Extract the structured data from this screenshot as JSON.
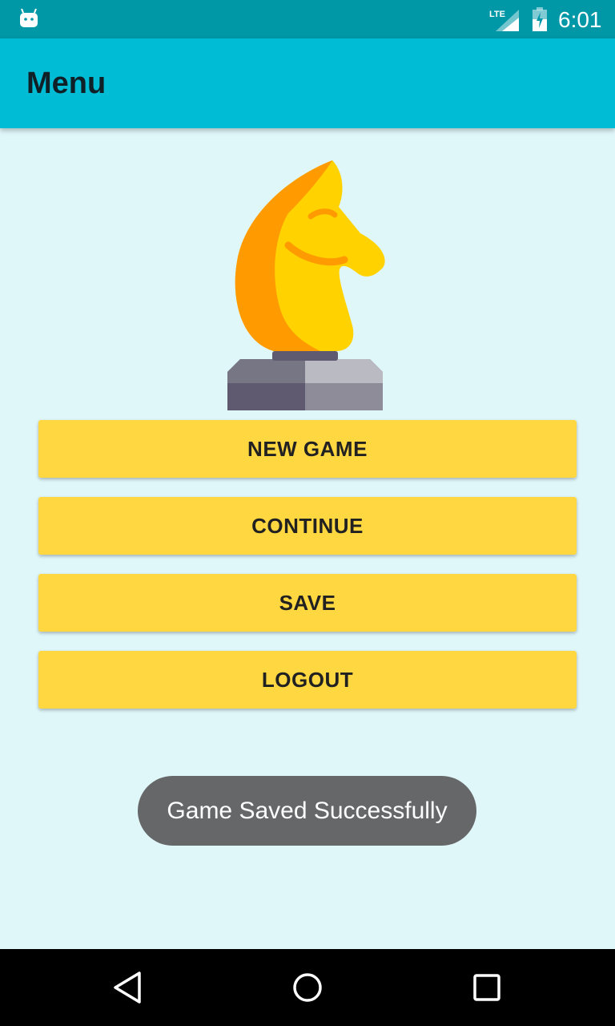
{
  "status_bar": {
    "time": "6:01",
    "network_label": "LTE",
    "icons": [
      "android-icon",
      "lte-signal-icon",
      "battery-icon"
    ]
  },
  "app_bar": {
    "title": "Menu"
  },
  "logo": {
    "icon": "chess-knight-icon"
  },
  "menu": {
    "buttons": [
      {
        "label": "NEW GAME"
      },
      {
        "label": "CONTINUE"
      },
      {
        "label": "SAVE"
      },
      {
        "label": "LOGOUT"
      }
    ]
  },
  "toast": {
    "message": "Game Saved Successfully"
  },
  "nav_bar": {
    "icons": [
      "back-icon",
      "home-icon",
      "recents-icon"
    ]
  },
  "colors": {
    "status_bar": "#0097A7",
    "app_bar": "#00BCD4",
    "background": "#E0F7FA",
    "button": "#FFD740",
    "toast": "#666769"
  }
}
